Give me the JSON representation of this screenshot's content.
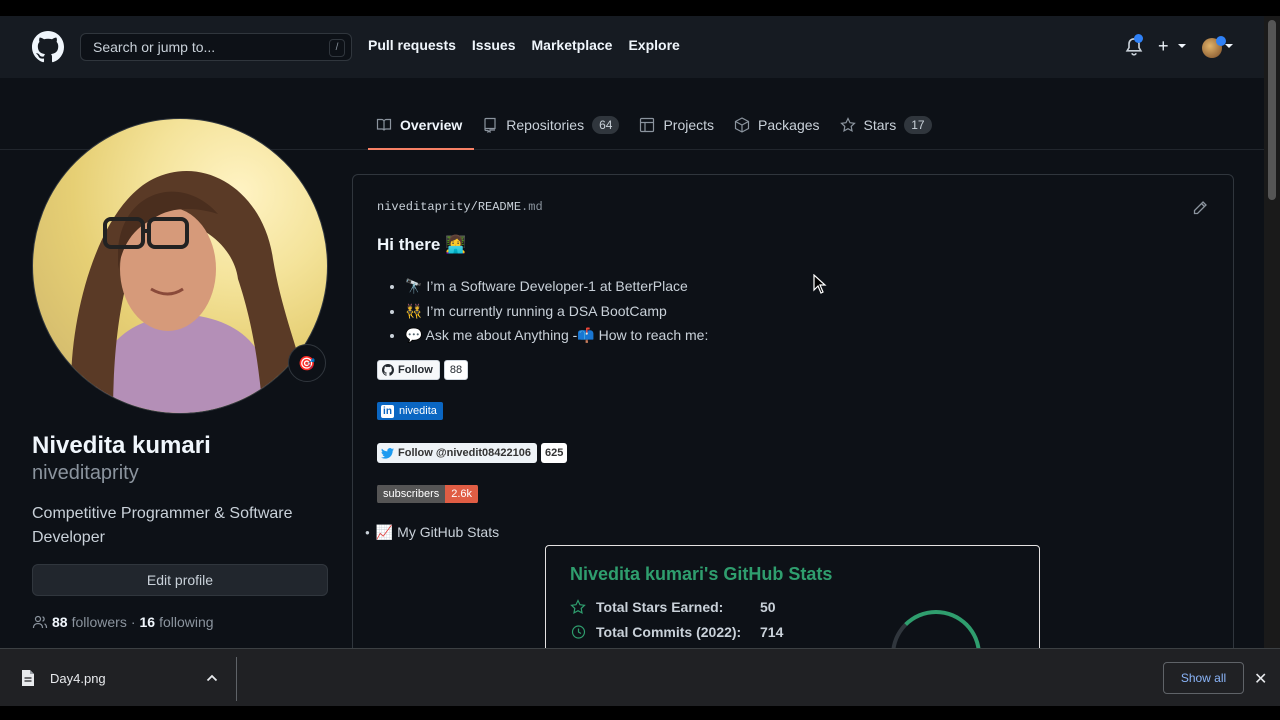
{
  "header": {
    "search_placeholder": "Search or jump to...",
    "search_shortcut": "/",
    "nav": [
      "Pull requests",
      "Issues",
      "Marketplace",
      "Explore"
    ]
  },
  "tabs": [
    {
      "label": "Overview",
      "icon": "book-icon",
      "count": ""
    },
    {
      "label": "Repositories",
      "icon": "repo-icon",
      "count": "64"
    },
    {
      "label": "Projects",
      "icon": "project-icon",
      "count": ""
    },
    {
      "label": "Packages",
      "icon": "package-icon",
      "count": ""
    },
    {
      "label": "Stars",
      "icon": "star-icon",
      "count": "17"
    }
  ],
  "profile": {
    "full_name": "Nivedita kumari",
    "username": "niveditaprity",
    "bio": "Competitive Programmer & Software Developer",
    "edit_label": "Edit profile",
    "followers_count": "88",
    "followers_label": "followers",
    "separator": "·",
    "following_count": "16",
    "following_label": "following",
    "status_emoji": "🎯"
  },
  "readme": {
    "path_user": "niveditaprity",
    "path_sep": "/",
    "path_file": "README",
    "path_ext": ".md",
    "heading": "Hi there 👩‍💻",
    "bullets": [
      "🔭 I’m a Software Developer-1 at BetterPlace",
      "👯 I’m currently running a DSA BootCamp",
      "💬 Ask me about Anything -📫 How to reach me:"
    ],
    "badges": {
      "github_follow": "Follow",
      "github_count": "88",
      "linkedin": "nivedita",
      "twitter_follow": "Follow @nivedit08422106",
      "twitter_count": "625",
      "subscribers_label": "subscribers",
      "subscribers_count": "2.6k"
    },
    "stats_bullet": "📈 My GitHub Stats",
    "stats_card": {
      "title": "Nivedita kumari's GitHub Stats",
      "rows": [
        {
          "label": "Total Stars Earned:",
          "value": "50"
        },
        {
          "label": "Total Commits (2022):",
          "value": "714"
        }
      ]
    }
  },
  "download_bar": {
    "file_name": "Day4.png",
    "show_all": "Show all",
    "close": "✕"
  }
}
